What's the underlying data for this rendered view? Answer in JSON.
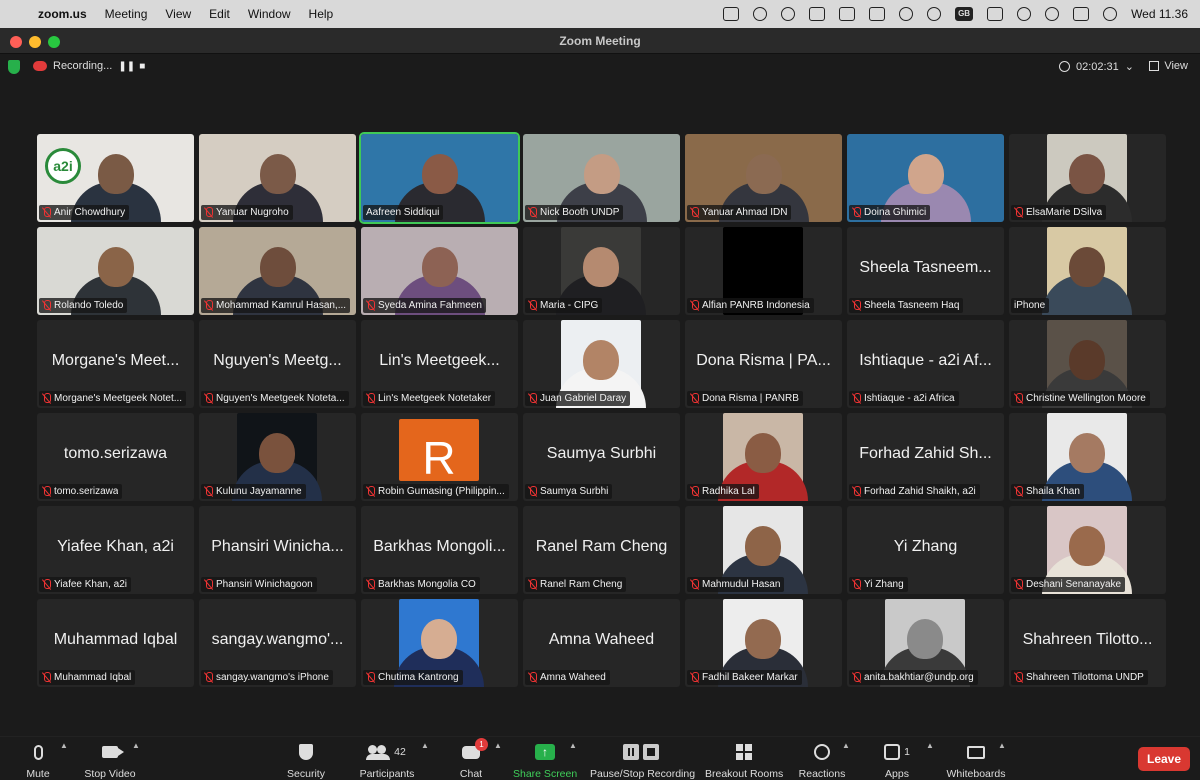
{
  "menubar": {
    "app": "zoom.us",
    "items": [
      "Meeting",
      "View",
      "Edit",
      "Window",
      "Help"
    ],
    "clock": "Wed  11.36",
    "keyboard": "GB"
  },
  "window": {
    "title": "Zoom Meeting"
  },
  "status": {
    "recording_label": "Recording...",
    "timer": "02:02:31",
    "view_label": "View"
  },
  "tiles": [
    {
      "name": "Anir Chowdhury",
      "kind": "video",
      "colors": [
        "#e8e6e2",
        "#7a5a45",
        "#2a3340"
      ],
      "logo": "a2i"
    },
    {
      "name": "Yanuar Nugroho",
      "kind": "video",
      "colors": [
        "#d5cdc2",
        "#7b5a48",
        "#2e2e38"
      ]
    },
    {
      "name": "Aafreen Siddiqui",
      "kind": "video",
      "colors": [
        "#2f76a8",
        "#8a5a46",
        "#2a2a30"
      ],
      "active": true
    },
    {
      "name": "Nick Booth UNDP",
      "kind": "video",
      "colors": [
        "#9aa59f",
        "#c49c84",
        "#3d3f48"
      ]
    },
    {
      "name": "Yanuar Ahmad IDN",
      "kind": "video",
      "colors": [
        "#8a6a4a",
        "#8b6a52",
        "#34363e"
      ]
    },
    {
      "name": "Doina Ghimici",
      "kind": "video",
      "colors": [
        "#2d6fa0",
        "#d0a58c",
        "#9a88b0"
      ]
    },
    {
      "name": "ElsaMarie DSilva",
      "kind": "video",
      "colors": [
        "#ccc9bf",
        "#7a5444",
        "#2c2c2c"
      ],
      "small": true
    },
    {
      "name": "Rolando Toledo",
      "kind": "video",
      "colors": [
        "#d9d9d4",
        "#8a6448",
        "#2e3338"
      ]
    },
    {
      "name": "Mohammad Kamrul Hasan,...",
      "kind": "video",
      "colors": [
        "#b5a996",
        "#6e4d3c",
        "#2f3440"
      ]
    },
    {
      "name": "Syeda Amina Fahmeen",
      "kind": "video",
      "colors": [
        "#b9aeb2",
        "#8d6254",
        "#6d4e7e"
      ]
    },
    {
      "name": "Maria - CIPG",
      "kind": "video",
      "colors": [
        "#3a3a38",
        "#b58a70",
        "#1f1f22"
      ],
      "small": true
    },
    {
      "name": "Alfian PANRB Indonesia",
      "kind": "black"
    },
    {
      "name": "Sheela Tasneem Haq",
      "kind": "text",
      "big": "Sheela Tasneem..."
    },
    {
      "name": "iPhone",
      "kind": "video",
      "colors": [
        "#d8c9a4",
        "#6b4a38",
        "#3a4a5a"
      ],
      "small": true
    },
    {
      "name": "Morgane's Meetgeek Notet...",
      "kind": "text",
      "big": "Morgane's Meet..."
    },
    {
      "name": "Nguyen's Meetgeek Noteta...",
      "kind": "text",
      "big": "Nguyen's Meetg..."
    },
    {
      "name": "Lin's Meetgeek Notetaker",
      "kind": "text",
      "big": "Lin's Meetgeek..."
    },
    {
      "name": "Juan Gabriel Daray",
      "kind": "video",
      "colors": [
        "#eceff2",
        "#b28466",
        "#f4f4f4"
      ],
      "small": true
    },
    {
      "name": "Dona Risma | PANRB",
      "kind": "text",
      "big": "Dona Risma | PA..."
    },
    {
      "name": "Ishtiaque - a2i Africa",
      "kind": "text",
      "big": "Ishtiaque - a2i Af..."
    },
    {
      "name": "Christine Wellington Moore",
      "kind": "video",
      "colors": [
        "#5a5148",
        "#5a3a2a",
        "#3a3a3a"
      ],
      "small": true
    },
    {
      "name": "tomo.serizawa",
      "kind": "text",
      "big": "tomo.serizawa"
    },
    {
      "name": "Kulunu Jayamanne",
      "kind": "video",
      "colors": [
        "#101418",
        "#7a523d",
        "#233048"
      ],
      "small": true
    },
    {
      "name": "Robin Gumasing (Philippin...",
      "kind": "letter",
      "letter": "R",
      "colors": [
        "#e4661c"
      ]
    },
    {
      "name": "Saumya Surbhi",
      "kind": "text",
      "big": "Saumya Surbhi"
    },
    {
      "name": "Radhika Lal",
      "kind": "video",
      "colors": [
        "#c9b7a6",
        "#8a5c44",
        "#b22828"
      ],
      "small": true
    },
    {
      "name": "Forhad Zahid Shaikh, a2i",
      "kind": "text",
      "big": "Forhad Zahid Sh..."
    },
    {
      "name": "Shaila Khan",
      "kind": "video",
      "colors": [
        "#e9e9e9",
        "#a57a62",
        "#2d4e7c"
      ],
      "small": true
    },
    {
      "name": "Yiafee Khan, a2i",
      "kind": "text",
      "big": "Yiafee Khan, a2i"
    },
    {
      "name": "Phansiri Winichagoon",
      "kind": "text",
      "big": "Phansiri Winicha..."
    },
    {
      "name": "Barkhas Mongolia CO",
      "kind": "text",
      "big": "Barkhas Mongoli..."
    },
    {
      "name": "Ranel Ram Cheng",
      "kind": "text",
      "big": "Ranel Ram Cheng"
    },
    {
      "name": "Mahmudul Hasan",
      "kind": "video",
      "colors": [
        "#e6e6e6",
        "#8e6448",
        "#2c3442"
      ],
      "small": true
    },
    {
      "name": "Yi Zhang",
      "kind": "text",
      "big": "Yi Zhang"
    },
    {
      "name": "Deshani Senanayake",
      "kind": "video",
      "colors": [
        "#d9c6c6",
        "#9a6a4c",
        "#e8e2d8"
      ],
      "small": true
    },
    {
      "name": "Muhammad Iqbal",
      "kind": "text",
      "big": "Muhammad Iqbal"
    },
    {
      "name": "sangay.wangmo's iPhone",
      "kind": "text",
      "big": "sangay.wangmo'..."
    },
    {
      "name": "Chutima Kantrong",
      "kind": "video",
      "colors": [
        "#2f78d0",
        "#d6ad92",
        "#1f2e5a"
      ],
      "small": true
    },
    {
      "name": "Amna Waheed",
      "kind": "text",
      "big": "Amna Waheed"
    },
    {
      "name": "Fadhil Bakeer Markar",
      "kind": "video",
      "colors": [
        "#ededed",
        "#936a50",
        "#2a2e38"
      ],
      "small": true
    },
    {
      "name": "anita.bakhtiar@undp.org",
      "kind": "video",
      "colors": [
        "#c9c9c9",
        "#8a8a8a",
        "#3a3a3a"
      ],
      "small": true
    },
    {
      "name": "Shahreen Tilottoma UNDP",
      "kind": "text",
      "big": "Shahreen Tilotto..."
    }
  ],
  "toolbar": {
    "mute": "Mute",
    "stop_video": "Stop Video",
    "security": "Security",
    "participants": "Participants",
    "participants_count": "42",
    "chat": "Chat",
    "chat_badge": "1",
    "share_screen": "Share Screen",
    "recording": "Pause/Stop Recording",
    "breakout": "Breakout Rooms",
    "reactions": "Reactions",
    "apps": "Apps",
    "apps_count": "1",
    "whiteboards": "Whiteboards",
    "leave": "Leave"
  }
}
